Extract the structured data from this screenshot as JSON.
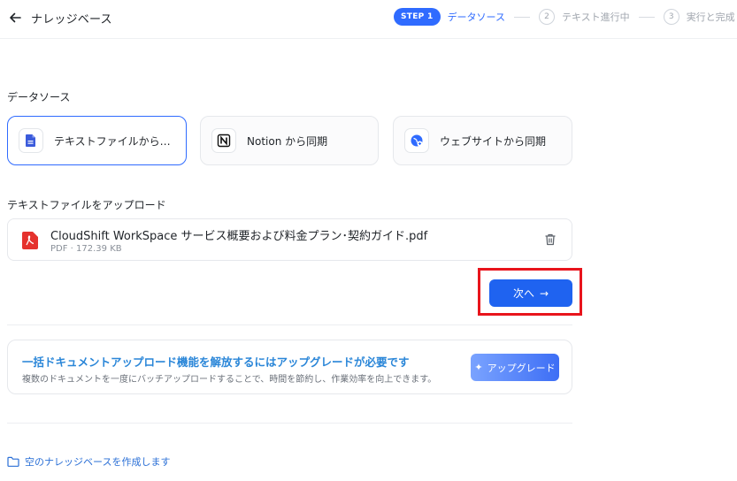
{
  "header": {
    "title": "ナレッジベース",
    "steps": [
      {
        "badge": "STEP 1",
        "label": "データソース"
      },
      {
        "number": "2",
        "label": "テキスト進行中"
      },
      {
        "number": "3",
        "label": "実行と完成"
      }
    ]
  },
  "datasource": {
    "label": "データソース",
    "options": [
      {
        "label": "テキストファイルからイン...",
        "icon": "document-icon"
      },
      {
        "label": "Notion から同期",
        "icon": "notion-icon"
      },
      {
        "label": "ウェブサイトから同期",
        "icon": "globe-icon"
      }
    ]
  },
  "upload": {
    "label": "テキストファイルをアップロード",
    "file": {
      "name": "CloudShift WorkSpace サービス概要および料金プラン･契約ガイド.pdf",
      "meta": "PDF · 172.39 KB"
    }
  },
  "next_button": {
    "label": "次へ",
    "arrow": "→"
  },
  "upgrade": {
    "title": "一括ドキュメントアップロード機能を解放するにはアップグレードが必要です",
    "description": "複数のドキュメントを一度にバッチアップロードすることで、時間を節約し、作業効率を向上できます。",
    "button": {
      "icon": "✦",
      "label": "アップグレード"
    }
  },
  "empty_kb": {
    "label": "空のナレッジベースを作成します"
  },
  "colors": {
    "accent": "#2f6bff",
    "highlight": "#e8141c",
    "pdf": "#e5322d"
  }
}
